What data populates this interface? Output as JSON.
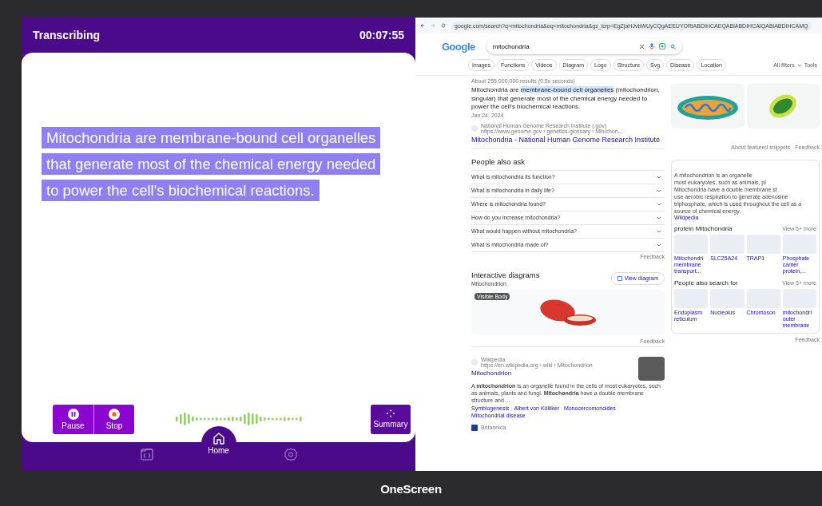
{
  "app": {
    "status": "Transcribing",
    "timer": "00:07:55",
    "transcript": [
      "Mitochondria are membrane-bound cell organelles",
      "that generate most of the chemical energy needed",
      "to power the cell's biochemical reactions."
    ],
    "controls": [
      {
        "kind": "pause",
        "label": "Pause"
      },
      {
        "kind": "stop",
        "label": "Stop"
      }
    ],
    "summary_button": "Summary",
    "nav": [
      {
        "kind": "library",
        "selected": false
      },
      {
        "kind": "home",
        "label": "Home",
        "selected": true
      },
      {
        "kind": "settings",
        "selected": false
      }
    ]
  },
  "browser": {
    "url": "google.com/search?q=mitochondria&oq=mitochondria&gs_lcrp=EgZjaHJvbWUyCQgAEEUYORiABDIHCAEQABiABDIHCAIQABiABDIHCAMQ",
    "logo": "Google",
    "search": {
      "value": "mitochondria"
    },
    "chips": [
      "Images",
      "Functions",
      "Videos",
      "Diagram",
      "Logo",
      "Structure",
      "Svg",
      "Disease",
      "Location"
    ],
    "all_filters": "All filters",
    "tools": "Tools",
    "result_stats": "About 255,000,000 results (0.5s seconds)",
    "snippet": {
      "lead": "Mitochondria are ",
      "highlight": "membrane-bound cell organelles",
      "rest": " (mitochondrion, singular) that generate most of the chemical energy needed to power the cell's biochemical reactions.",
      "date": "Jan 24, 2024",
      "source": "National Human Genome Research Institute (.gov)",
      "source_url": "https://www.genome.gov › genetics-glossary › Mitochon...",
      "title": "Mitochondria - National Human Genome Research Institute"
    },
    "featured_footer": [
      "About featured snippets",
      "Feedback"
    ],
    "people_also_ask": {
      "title": "People also ask",
      "questions": [
        {
          "text": "What is mitochondria its function?",
          "expanded": false
        },
        {
          "text": "What is mitochondria in daily life?",
          "expanded": false
        },
        {
          "text": "Where is mitochondria found?",
          "expanded": false
        },
        {
          "text": "How do you increase mitochondria?",
          "expanded": false
        },
        {
          "text": "What would happen without mitochondria?",
          "expanded": false
        },
        {
          "text": "What is mitochondria made of?",
          "expanded": false
        }
      ],
      "feedback": "Feedback"
    },
    "diagrams": {
      "title": "Interactive diagrams",
      "subtitle": "Mitochondrion",
      "button": "View diagram",
      "badge": "Visible Body",
      "feedback": "Feedback"
    },
    "wiki": {
      "source": "Wikipedia",
      "url": "https://en.wikipedia.org › wiki › Mitochondrion",
      "title": "Mitochondrion",
      "text": "A **mitochondrion** is an organelle found in the cells of most eukaryotes, such as animals, plants and fungi. **Mitochondria** have a double membrane structure and ...",
      "links": [
        "Symbiogenesis",
        "Albert von Kölliker",
        "Monocercomonoides",
        "Mitochondrial disease"
      ]
    },
    "next_source": "Britannica",
    "panel": {
      "description": [
        "A mitochondrion is an organelle",
        "most eukaryotes, such as animals, pl",
        "Mitochondria have a double membrane st",
        "use aerobic respiration to generate adenosine",
        "triphosphate, which is used throughout the cell as a"
      ],
      "last_line": "source of chemical energy.",
      "link": "Wikipedia",
      "sections": [
        {
          "title": "protein Mitochondria",
          "more": "View 5+ more",
          "items": [
            "Mitochondri membrane transport...",
            "SLC25A24",
            "TRAP1",
            "Phosphate carrier protein,..."
          ]
        },
        {
          "title": "People also search for",
          "more": "View 5+ more",
          "items": [
            "Endoplasm reticulum",
            "Nucleolus",
            "Chromoson",
            "mitochondri outer membrane"
          ]
        }
      ],
      "feedback": "Feedback"
    }
  },
  "brand": "OneScreen"
}
